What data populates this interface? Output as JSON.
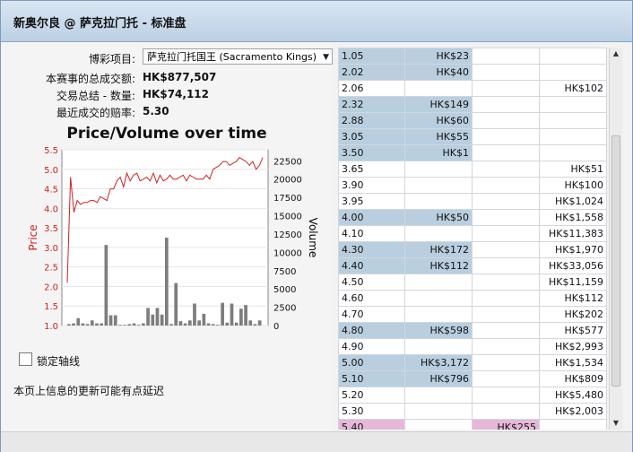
{
  "window": {
    "title": "新奥尔良 @ 萨克拉门托 - 标准盘"
  },
  "summary": {
    "market_label": "博彩项目:",
    "market_value": "萨克拉门托国王 (Sacramento Kings)",
    "total_matched_label": "本赛事的总成交额:",
    "total_matched_value": "HK$877,507",
    "traded_label": "交易总结 - 数量:",
    "traded_value": "HK$74,112",
    "last_price_label": "最近成交的赔率:",
    "last_price_value": "5.30"
  },
  "options": {
    "lock_axis_label": "锁定轴线",
    "delay_note": "本页上信息的更新可能有点延迟"
  },
  "colors": {
    "price_line": "#cc2222",
    "volume_bar": "#7d7d7d",
    "back_cell": "#b9cfe0",
    "lay_cell": "#e6b8d8"
  },
  "chart_data": {
    "type": "line",
    "title": "Price/Volume over time",
    "ylabel": "Price",
    "y2label": "Volume",
    "ylim": [
      1.0,
      5.5
    ],
    "y2lim": [
      0,
      24000
    ],
    "yticks": [
      "1.0",
      "1.5",
      "2.0",
      "2.5",
      "3.0",
      "3.5",
      "4.0",
      "4.5",
      "5.0",
      "5.5"
    ],
    "y2ticks": [
      "0",
      "2500",
      "5000",
      "7500",
      "10000",
      "12500",
      "15000",
      "17500",
      "20000",
      "22500"
    ],
    "price": [
      2.1,
      4.8,
      3.9,
      4.2,
      4.1,
      4.15,
      4.15,
      4.2,
      4.2,
      4.15,
      4.3,
      4.25,
      4.2,
      4.5,
      4.5,
      4.7,
      4.8,
      4.55,
      4.9,
      4.7,
      4.85,
      4.9,
      4.7,
      4.75,
      4.8,
      4.7,
      4.9,
      4.65,
      4.85,
      4.7,
      4.75,
      4.85,
      4.75,
      4.75,
      4.8,
      4.85,
      4.7,
      4.85,
      4.8,
      4.75,
      4.75,
      4.75,
      4.85,
      4.75,
      5.0,
      5.05,
      5.1,
      5.2,
      5.2,
      5.1,
      5.15,
      5.2,
      5.3,
      5.25,
      5.2,
      5.1,
      5.2,
      5.0,
      5.1,
      5.3
    ],
    "volume": [
      200,
      300,
      1000,
      300,
      200,
      700,
      300,
      300,
      11000,
      1400,
      1400,
      100,
      100,
      200,
      300,
      100,
      300,
      2400,
      1500,
      2400,
      1500,
      12000,
      200,
      5800,
      600,
      300,
      700,
      3000,
      700,
      1600,
      300,
      200,
      100,
      3100,
      400,
      3000,
      400,
      2300,
      2800,
      700,
      200,
      700
    ]
  },
  "table": {
    "rows": [
      {
        "odds": "1.05",
        "back": "HK$23",
        "lay": "",
        "traded": "",
        "style": "blue"
      },
      {
        "odds": "2.02",
        "back": "HK$40",
        "lay": "",
        "traded": "",
        "style": "blue"
      },
      {
        "odds": "2.06",
        "back": "",
        "lay": "",
        "traded": "HK$102",
        "style": ""
      },
      {
        "odds": "2.32",
        "back": "HK$149",
        "lay": "",
        "traded": "",
        "style": "blue"
      },
      {
        "odds": "2.88",
        "back": "HK$60",
        "lay": "",
        "traded": "",
        "style": "blue"
      },
      {
        "odds": "3.05",
        "back": "HK$55",
        "lay": "",
        "traded": "",
        "style": "blue"
      },
      {
        "odds": "3.50",
        "back": "HK$1",
        "lay": "",
        "traded": "",
        "style": "blue"
      },
      {
        "odds": "3.65",
        "back": "",
        "lay": "",
        "traded": "HK$51",
        "style": ""
      },
      {
        "odds": "3.90",
        "back": "",
        "lay": "",
        "traded": "HK$100",
        "style": ""
      },
      {
        "odds": "3.95",
        "back": "",
        "lay": "",
        "traded": "HK$1,024",
        "style": ""
      },
      {
        "odds": "4.00",
        "back": "HK$50",
        "lay": "",
        "traded": "HK$1,558",
        "style": "blue"
      },
      {
        "odds": "4.10",
        "back": "",
        "lay": "",
        "traded": "HK$11,383",
        "style": ""
      },
      {
        "odds": "4.30",
        "back": "HK$172",
        "lay": "",
        "traded": "HK$1,970",
        "style": "blue"
      },
      {
        "odds": "4.40",
        "back": "HK$112",
        "lay": "",
        "traded": "HK$33,056",
        "style": "blue"
      },
      {
        "odds": "4.50",
        "back": "",
        "lay": "",
        "traded": "HK$11,159",
        "style": ""
      },
      {
        "odds": "4.60",
        "back": "",
        "lay": "",
        "traded": "HK$112",
        "style": ""
      },
      {
        "odds": "4.70",
        "back": "",
        "lay": "",
        "traded": "HK$202",
        "style": ""
      },
      {
        "odds": "4.80",
        "back": "HK$598",
        "lay": "",
        "traded": "HK$577",
        "style": "blue"
      },
      {
        "odds": "4.90",
        "back": "",
        "lay": "",
        "traded": "HK$2,993",
        "style": ""
      },
      {
        "odds": "5.00",
        "back": "HK$3,172",
        "lay": "",
        "traded": "HK$1,534",
        "style": "blue"
      },
      {
        "odds": "5.10",
        "back": "HK$796",
        "lay": "",
        "traded": "HK$809",
        "style": "blue"
      },
      {
        "odds": "5.20",
        "back": "",
        "lay": "",
        "traded": "HK$5,480",
        "style": ""
      },
      {
        "odds": "5.30",
        "back": "",
        "lay": "",
        "traded": "HK$2,003",
        "style": ""
      },
      {
        "odds": "5.40",
        "back": "",
        "lay": "HK$255",
        "traded": "",
        "style": "pink"
      }
    ]
  }
}
